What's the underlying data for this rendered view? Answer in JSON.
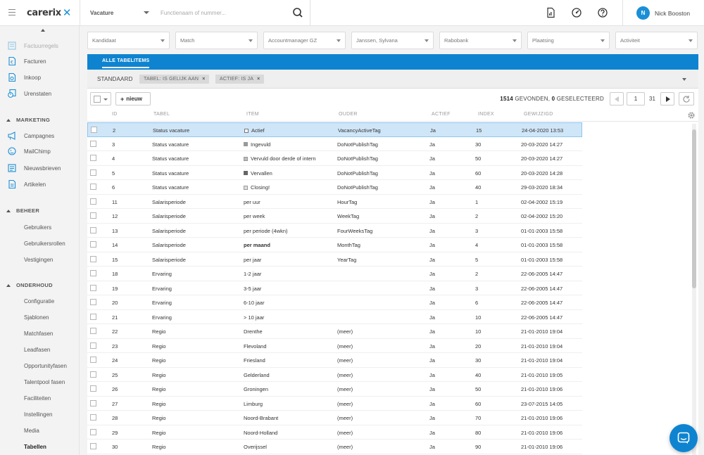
{
  "header": {
    "logo_text": "carerix",
    "search_type": "Vacature",
    "search_placeholder": "Functienaam of nummer...",
    "user_initial": "N",
    "user_name": "Nick Booston"
  },
  "sidebar": {
    "top_items": [
      {
        "label": "Factuurregels",
        "icon": "invoice-lines-icon"
      },
      {
        "label": "Facturen",
        "icon": "invoice-icon"
      },
      {
        "label": "Inkoop",
        "icon": "purchase-icon"
      },
      {
        "label": "Urenstaten",
        "icon": "timesheet-icon"
      }
    ],
    "marketing": {
      "title": "MARKETING",
      "items": [
        {
          "label": "Campagnes",
          "icon": "megaphone-icon"
        },
        {
          "label": "MailChimp",
          "icon": "mailchimp-icon"
        },
        {
          "label": "Nieuwsbrieven",
          "icon": "newsletter-icon"
        },
        {
          "label": "Artikelen",
          "icon": "article-icon"
        }
      ]
    },
    "beheer": {
      "title": "BEHEER",
      "items": [
        "Gebruikers",
        "Gebruikersrollen",
        "Vestigingen"
      ]
    },
    "onderhoud": {
      "title": "ONDERHOUD",
      "items": [
        "Configuratie",
        "Sjablonen",
        "Matchfasen",
        "Leadfasen",
        "Opportunityfasen",
        "Talentpool fasen",
        "Faciliteiten",
        "Instellingen",
        "Media",
        "Tabellen"
      ],
      "active": "Tabellen"
    }
  },
  "filters": [
    "Kandidaat",
    "Match",
    "Accountmanager GZ",
    "Janssen, Sylvana",
    "Rabobank",
    "Plaatsing",
    "Activiteit"
  ],
  "panel": {
    "tab_label": "ALLE TABELITEMS",
    "view_name": "STANDAARD",
    "chips": [
      "TABEL: IS GELIJK AAN",
      "ACTIEF: IS JA"
    ],
    "new_label": "nieuw",
    "count_found": "1514",
    "count_found_label": "GEVONDEN,",
    "count_selected": "0",
    "count_selected_label": "GESELECTEERD",
    "page": "1",
    "page_total": "31"
  },
  "table": {
    "columns": [
      "ID",
      "TABEL",
      "ITEM",
      "OUDER",
      "ACTIEF",
      "INDEX",
      "GEWIJZIGD"
    ],
    "rows": [
      {
        "id": "2",
        "tabel": "Status vacature",
        "item": "Actief",
        "marker": "empty",
        "ouder": "VacancyActiveTag",
        "actief": "Ja",
        "index": "15",
        "gewijzigd": "24-04-2020 13:53",
        "selected": true
      },
      {
        "id": "3",
        "tabel": "Status vacature",
        "item": "Ingevuld",
        "marker": "grey",
        "ouder": "DoNotPublishTag",
        "actief": "Ja",
        "index": "30",
        "gewijzigd": "20-03-2020 14:27"
      },
      {
        "id": "4",
        "tabel": "Status vacature",
        "item": "Vervuld door derde of intern",
        "marker": "light",
        "ouder": "DoNotPublishTag",
        "actief": "Ja",
        "index": "50",
        "gewijzigd": "20-03-2020 14:27"
      },
      {
        "id": "5",
        "tabel": "Status vacature",
        "item": "Vervallen",
        "marker": "filled",
        "ouder": "DoNotPublishTag",
        "actief": "Ja",
        "index": "60",
        "gewijzigd": "20-03-2020 14:28"
      },
      {
        "id": "6",
        "tabel": "Status vacature",
        "item": "Closing!",
        "marker": "hatch",
        "ouder": "DoNotPublishTag",
        "actief": "Ja",
        "index": "40",
        "gewijzigd": "29-03-2020 18:34"
      },
      {
        "id": "11",
        "tabel": "Salarisperiode",
        "item": "per uur",
        "ouder": "HourTag",
        "actief": "Ja",
        "index": "1",
        "gewijzigd": "02-04-2002 15:19"
      },
      {
        "id": "12",
        "tabel": "Salarisperiode",
        "item": "per week",
        "ouder": "WeekTag",
        "actief": "Ja",
        "index": "2",
        "gewijzigd": "02-04-2002 15:20"
      },
      {
        "id": "13",
        "tabel": "Salarisperiode",
        "item": "per periode (4wkn)",
        "ouder": "FourWeeksTag",
        "actief": "Ja",
        "index": "3",
        "gewijzigd": "01-01-2003 15:58"
      },
      {
        "id": "14",
        "tabel": "Salarisperiode",
        "item": "per maand",
        "bold": true,
        "ouder": "MonthTag",
        "actief": "Ja",
        "index": "4",
        "gewijzigd": "01-01-2003 15:58"
      },
      {
        "id": "15",
        "tabel": "Salarisperiode",
        "item": "per jaar",
        "ouder": "YearTag",
        "actief": "Ja",
        "index": "5",
        "gewijzigd": "01-01-2003 15:58"
      },
      {
        "id": "18",
        "tabel": "Ervaring",
        "item": "1-2 jaar",
        "ouder": "",
        "actief": "Ja",
        "index": "2",
        "gewijzigd": "22-06-2005 14:47"
      },
      {
        "id": "19",
        "tabel": "Ervaring",
        "item": "3-5 jaar",
        "ouder": "",
        "actief": "Ja",
        "index": "3",
        "gewijzigd": "22-06-2005 14:47"
      },
      {
        "id": "20",
        "tabel": "Ervaring",
        "item": "6-10 jaar",
        "ouder": "",
        "actief": "Ja",
        "index": "6",
        "gewijzigd": "22-06-2005 14:47"
      },
      {
        "id": "21",
        "tabel": "Ervaring",
        "item": "> 10 jaar",
        "ouder": "",
        "actief": "Ja",
        "index": "10",
        "gewijzigd": "22-06-2005 14:47"
      },
      {
        "id": "22",
        "tabel": "Regio",
        "item": "Drenthe",
        "ouder": "(meer)",
        "actief": "Ja",
        "index": "10",
        "gewijzigd": "21-01-2010 19:04"
      },
      {
        "id": "23",
        "tabel": "Regio",
        "item": "Flevoland",
        "ouder": "(meer)",
        "actief": "Ja",
        "index": "20",
        "gewijzigd": "21-01-2010 19:04"
      },
      {
        "id": "24",
        "tabel": "Regio",
        "item": "Friesland",
        "ouder": "(meer)",
        "actief": "Ja",
        "index": "30",
        "gewijzigd": "21-01-2010 19:04"
      },
      {
        "id": "25",
        "tabel": "Regio",
        "item": "Gelderland",
        "ouder": "(meer)",
        "actief": "Ja",
        "index": "40",
        "gewijzigd": "21-01-2010 19:05"
      },
      {
        "id": "26",
        "tabel": "Regio",
        "item": "Groningen",
        "ouder": "(meer)",
        "actief": "Ja",
        "index": "50",
        "gewijzigd": "21-01-2010 19:06"
      },
      {
        "id": "27",
        "tabel": "Regio",
        "item": "Limburg",
        "ouder": "(meer)",
        "actief": "Ja",
        "index": "60",
        "gewijzigd": "23-07-2015 14:05"
      },
      {
        "id": "28",
        "tabel": "Regio",
        "item": "Noord-Brabant",
        "ouder": "(meer)",
        "actief": "Ja",
        "index": "70",
        "gewijzigd": "21-01-2010 19:06"
      },
      {
        "id": "29",
        "tabel": "Regio",
        "item": "Noord-Holland",
        "ouder": "(meer)",
        "actief": "Ja",
        "index": "80",
        "gewijzigd": "21-01-2010 19:06"
      },
      {
        "id": "30",
        "tabel": "Regio",
        "item": "Overijssel",
        "ouder": "(meer)",
        "actief": "Ja",
        "index": "90",
        "gewijzigd": "21-01-2010 19:06"
      }
    ]
  },
  "colors": {
    "accent": "#0e84d0",
    "selected_row": "#cfe6f8"
  }
}
